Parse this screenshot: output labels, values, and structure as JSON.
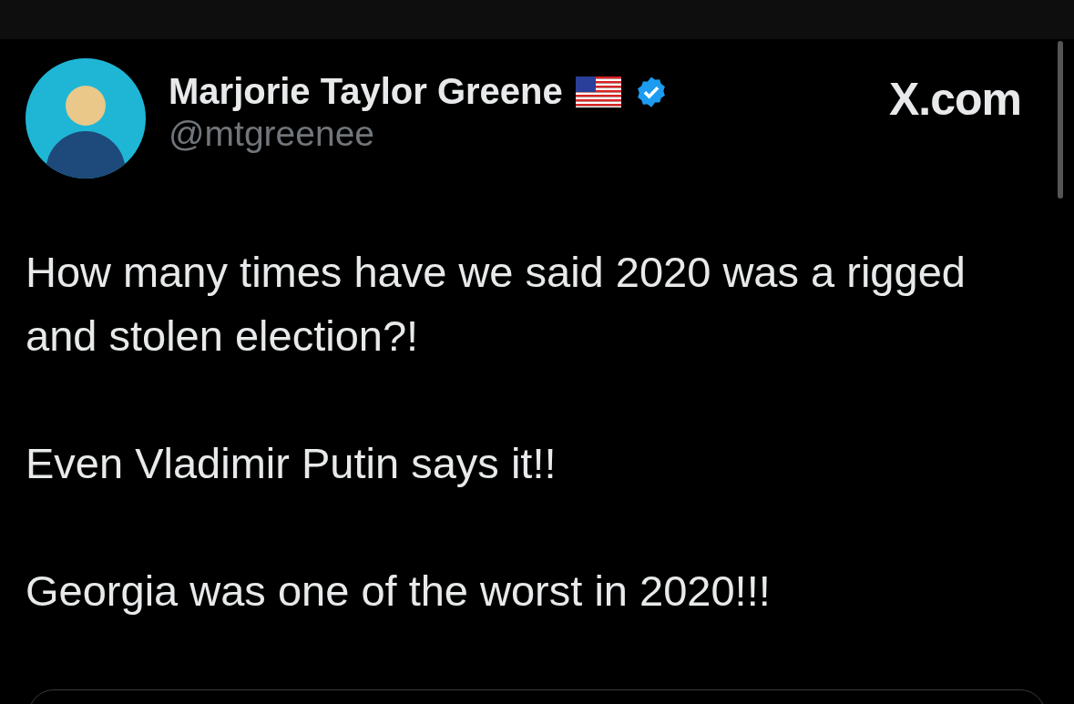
{
  "author": {
    "name": "Marjorie Taylor Greene",
    "handle": "@mtgreenee",
    "verified": true
  },
  "site": "X.com",
  "paragraphs": [
    "How many times have we said 2020 was a rigged and stolen election?!",
    "Even Vladimir Putin says it!!",
    "Georgia was one of the worst in 2020!!!"
  ]
}
